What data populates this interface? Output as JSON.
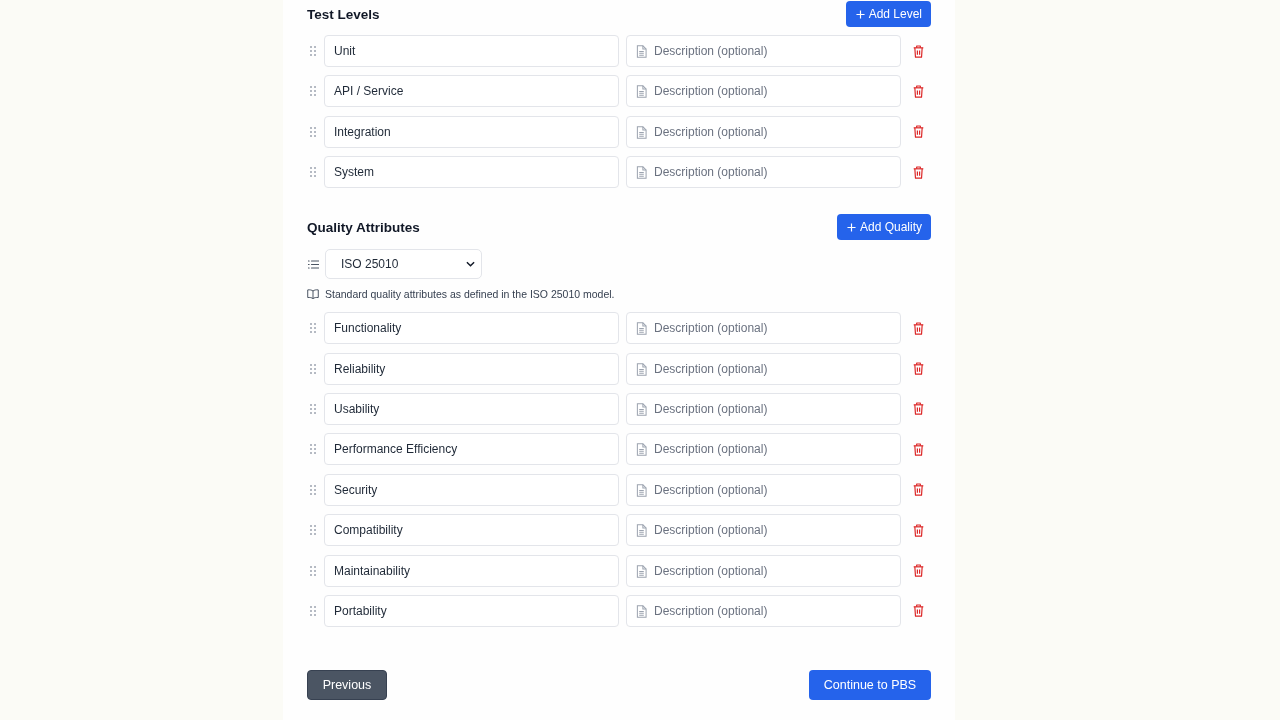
{
  "test_levels": {
    "title": "Test Levels",
    "add_button": {
      "label": "Add Level"
    },
    "items": [
      {
        "name": {
          "value": "Unit"
        },
        "description": {
          "placeholder": "Description (optional)"
        }
      },
      {
        "name": {
          "value": "API / Service"
        },
        "description": {
          "placeholder": "Description (optional)"
        }
      },
      {
        "name": {
          "value": "Integration"
        },
        "description": {
          "placeholder": "Description (optional)"
        }
      },
      {
        "name": {
          "value": "System"
        },
        "description": {
          "placeholder": "Description (optional)"
        }
      }
    ]
  },
  "quality_attributes": {
    "title": "Quality Attributes",
    "add_button": {
      "label": "Add Quality"
    },
    "model_select": {
      "value": "ISO 25010"
    },
    "help_text": "Standard quality attributes as defined in the ISO 25010 model.",
    "items": [
      {
        "name": {
          "value": "Functionality"
        },
        "description": {
          "placeholder": "Description (optional)"
        }
      },
      {
        "name": {
          "value": "Reliability"
        },
        "description": {
          "placeholder": "Description (optional)"
        }
      },
      {
        "name": {
          "value": "Usability"
        },
        "description": {
          "placeholder": "Description (optional)"
        }
      },
      {
        "name": {
          "value": "Performance Efficiency"
        },
        "description": {
          "placeholder": "Description (optional)"
        }
      },
      {
        "name": {
          "value": "Security"
        },
        "description": {
          "placeholder": "Description (optional)"
        }
      },
      {
        "name": {
          "value": "Compatibility"
        },
        "description": {
          "placeholder": "Description (optional)"
        }
      },
      {
        "name": {
          "value": "Maintainability"
        },
        "description": {
          "placeholder": "Description (optional)"
        }
      },
      {
        "name": {
          "value": "Portability"
        },
        "description": {
          "placeholder": "Description (optional)"
        }
      }
    ]
  },
  "footer": {
    "buttons": [
      {
        "label": "Previous",
        "kind": "secondary"
      },
      {
        "label": "Continue to PBS",
        "kind": "primary"
      }
    ]
  }
}
